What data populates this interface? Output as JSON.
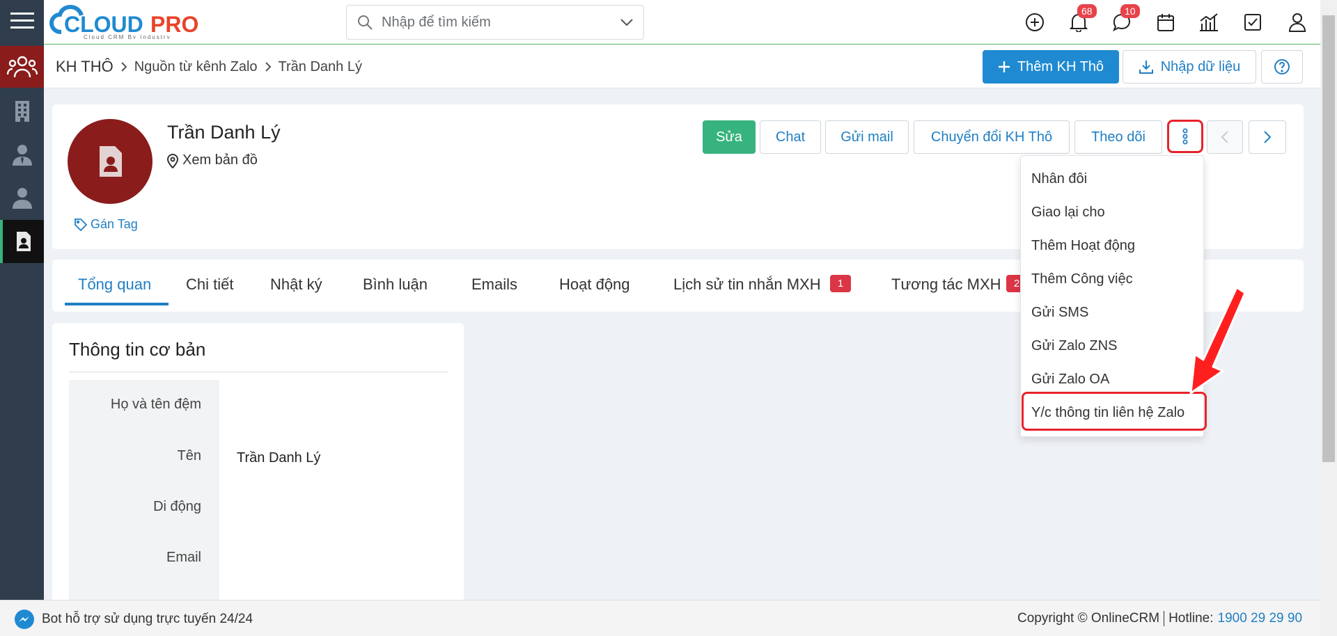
{
  "brand": {
    "logo_text": "CLOUDPRO",
    "tagline": "Cloud CRM By Industry"
  },
  "search": {
    "placeholder": "Nhập để tìm kiếm"
  },
  "header": {
    "notifications_count": "68",
    "messages_count": "10"
  },
  "breadcrumb": [
    "KH THÔ",
    "Nguồn từ kênh Zalo",
    "Trần Danh Lý"
  ],
  "top_actions": {
    "add_label": "Thêm KH Thô",
    "import_label": "Nhập dữ liệu"
  },
  "profile": {
    "name": "Trần Danh Lý",
    "map_link": "Xem bản đồ",
    "tag_link": "Gán Tag"
  },
  "record_actions": {
    "edit": "Sửa",
    "chat": "Chat",
    "send_mail": "Gửi mail",
    "convert": "Chuyển đổi KH Thô",
    "follow": "Theo dõi"
  },
  "more_menu": [
    "Nhân đôi",
    "Giao lại cho",
    "Thêm Hoạt động",
    "Thêm Công việc",
    "Gửi SMS",
    "Gửi Zalo ZNS",
    "Gửi Zalo OA",
    "Y/c thông tin liên hệ Zalo"
  ],
  "tabs": [
    {
      "label": "Tổng quan"
    },
    {
      "label": "Chi tiết"
    },
    {
      "label": "Nhật ký"
    },
    {
      "label": "Bình luận"
    },
    {
      "label": "Emails"
    },
    {
      "label": "Hoạt động"
    },
    {
      "label": "Lịch sử tin nhắn MXH",
      "badge": "1"
    },
    {
      "label": "Tương tác MXH",
      "badge": "2"
    }
  ],
  "basic_info": {
    "title": "Thông tin cơ bản",
    "fields": [
      {
        "label": "Họ và tên đệm",
        "value": ""
      },
      {
        "label": "Tên",
        "value": "Trần Danh Lý"
      },
      {
        "label": "Di động",
        "value": ""
      },
      {
        "label": "Email",
        "value": ""
      }
    ]
  },
  "footer": {
    "bot_text": "Bot hỗ trợ sử dụng trực tuyến 24/24",
    "copyright": "Copyright © OnlineCRM",
    "hotline_label": "Hotline:",
    "hotline_number": "1900 29 29 90"
  },
  "colors": {
    "primary": "#1f8ad1",
    "success": "#36b37e",
    "rail": "#2f3d4c",
    "rail_active": "#8a1c1c",
    "highlight": "#e8232b"
  }
}
